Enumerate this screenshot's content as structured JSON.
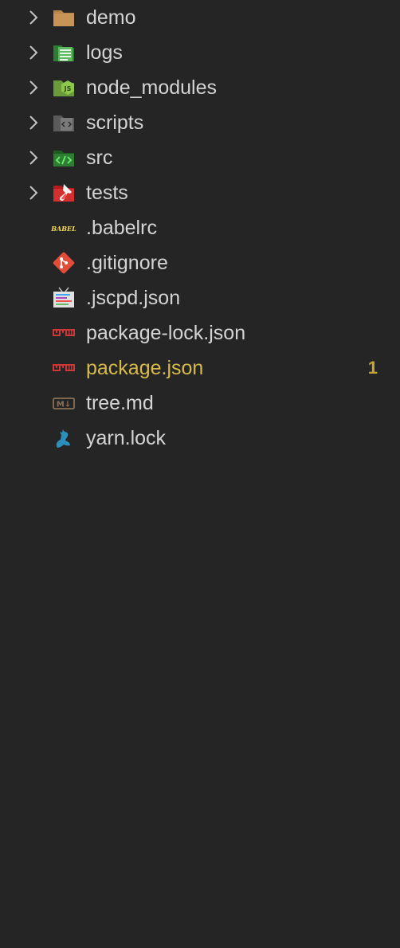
{
  "explorer": {
    "folders": [
      {
        "label": "demo",
        "icon": "folder-icon",
        "icon_color": "#b8874a"
      },
      {
        "label": "logs",
        "icon": "logs-folder-icon",
        "icon_color": "#3f9a3f"
      },
      {
        "label": "node_modules",
        "icon": "node-modules-folder-icon",
        "icon_color": "#8cbf4f"
      },
      {
        "label": "scripts",
        "icon": "scripts-folder-icon",
        "icon_color": "#6b6b6b"
      },
      {
        "label": "src",
        "icon": "src-folder-icon",
        "icon_color": "#2e7d32"
      },
      {
        "label": "tests",
        "icon": "tests-folder-icon",
        "icon_color": "#c62828"
      }
    ],
    "files": [
      {
        "label": ".babelrc",
        "icon": "babel-icon",
        "icon_color": "#f5da55",
        "icon_text": "BABEL"
      },
      {
        "label": ".gitignore",
        "icon": "git-icon",
        "icon_color": "#e44c3a"
      },
      {
        "label": ".jscpd.json",
        "icon": "jscpd-icon",
        "icon_color": "#cfcfcf"
      },
      {
        "label": "package-lock.json",
        "icon": "npm-icon",
        "icon_color": "#cb3837"
      },
      {
        "label": "package.json",
        "icon": "npm-icon",
        "icon_color": "#cb3837",
        "modified": true,
        "badge": "1"
      },
      {
        "label": "tree.md",
        "icon": "markdown-icon",
        "icon_color": "#8a7055",
        "icon_text": "M↓"
      },
      {
        "label": "yarn.lock",
        "icon": "yarn-icon",
        "icon_color": "#2c8ebb"
      }
    ]
  },
  "colors": {
    "background": "#252526",
    "text": "#d4d4d4",
    "modified_text": "#d7ba4a",
    "badge": "#c9a634",
    "chevron": "#c5c5c5"
  }
}
